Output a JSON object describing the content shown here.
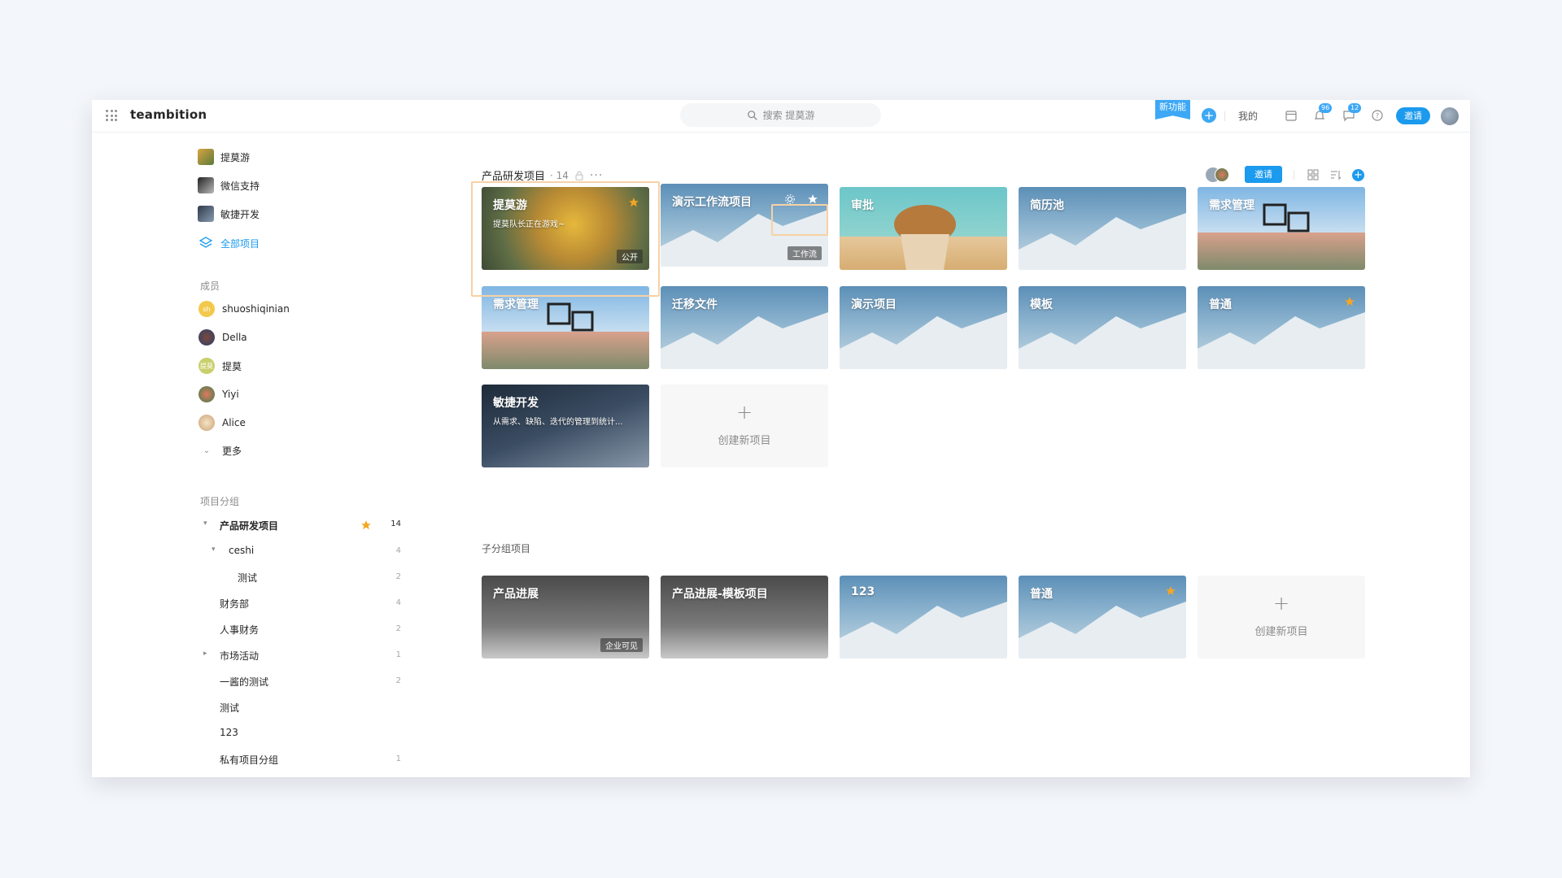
{
  "app": {
    "brand": "teambition"
  },
  "topbar": {
    "search_placeholder": "搜索 提莫游",
    "new_feature": "新功能",
    "mine": "我的",
    "notif_badge": "96",
    "msg_badge": "12",
    "invite": "邀请"
  },
  "sidebar": {
    "projects": [
      {
        "label": "提莫游"
      },
      {
        "label": "微信支持"
      },
      {
        "label": "敏捷开发"
      },
      {
        "label": "全部项目"
      }
    ],
    "members_title": "成员",
    "members": [
      {
        "name": "shuoshiqinian",
        "initials": "sh"
      },
      {
        "name": "Della"
      },
      {
        "name": "提莫",
        "initials": "提莫"
      },
      {
        "name": "Yiyi"
      },
      {
        "name": "Alice"
      }
    ],
    "more": "更多",
    "groups_title": "项目分组",
    "groups": [
      {
        "label": "产品研发项目",
        "count": "14"
      },
      {
        "label": "ceshi",
        "count": "4"
      },
      {
        "label": "测试",
        "count": "2"
      },
      {
        "label": "财务部",
        "count": "4"
      },
      {
        "label": "人事财务",
        "count": "2"
      },
      {
        "label": "市场活动",
        "count": "1"
      },
      {
        "label": "一酱的测试",
        "count": "2"
      },
      {
        "label": "测试",
        "count": ""
      },
      {
        "label": "123",
        "count": ""
      },
      {
        "label": "私有项目分组",
        "count": "1"
      }
    ]
  },
  "main": {
    "title": "产品研发项目",
    "count": "· 14",
    "invite": "邀请",
    "cards": [
      {
        "title": "提莫游",
        "desc": "提莫队长正在游戏~",
        "tag": "公开"
      },
      {
        "title": "演示工作流项目",
        "tag": "工作流"
      },
      {
        "title": "审批"
      },
      {
        "title": "简历池"
      },
      {
        "title": "需求管理"
      },
      {
        "title": "需求管理"
      },
      {
        "title": "迁移文件"
      },
      {
        "title": "演示项目"
      },
      {
        "title": "模板"
      },
      {
        "title": "普通"
      },
      {
        "title": "敏捷开发",
        "desc": "从需求、缺陷、迭代的管理到统计..."
      }
    ],
    "create_label": "创建新项目",
    "sub_title": "子分组项目",
    "sub_cards": [
      {
        "title": "产品进展",
        "tag": "企业可见"
      },
      {
        "title": "产品进展-模板项目"
      },
      {
        "title": "123"
      },
      {
        "title": "普通"
      }
    ]
  },
  "colors": {
    "accent": "#1b9aee",
    "star": "#f5a623"
  }
}
